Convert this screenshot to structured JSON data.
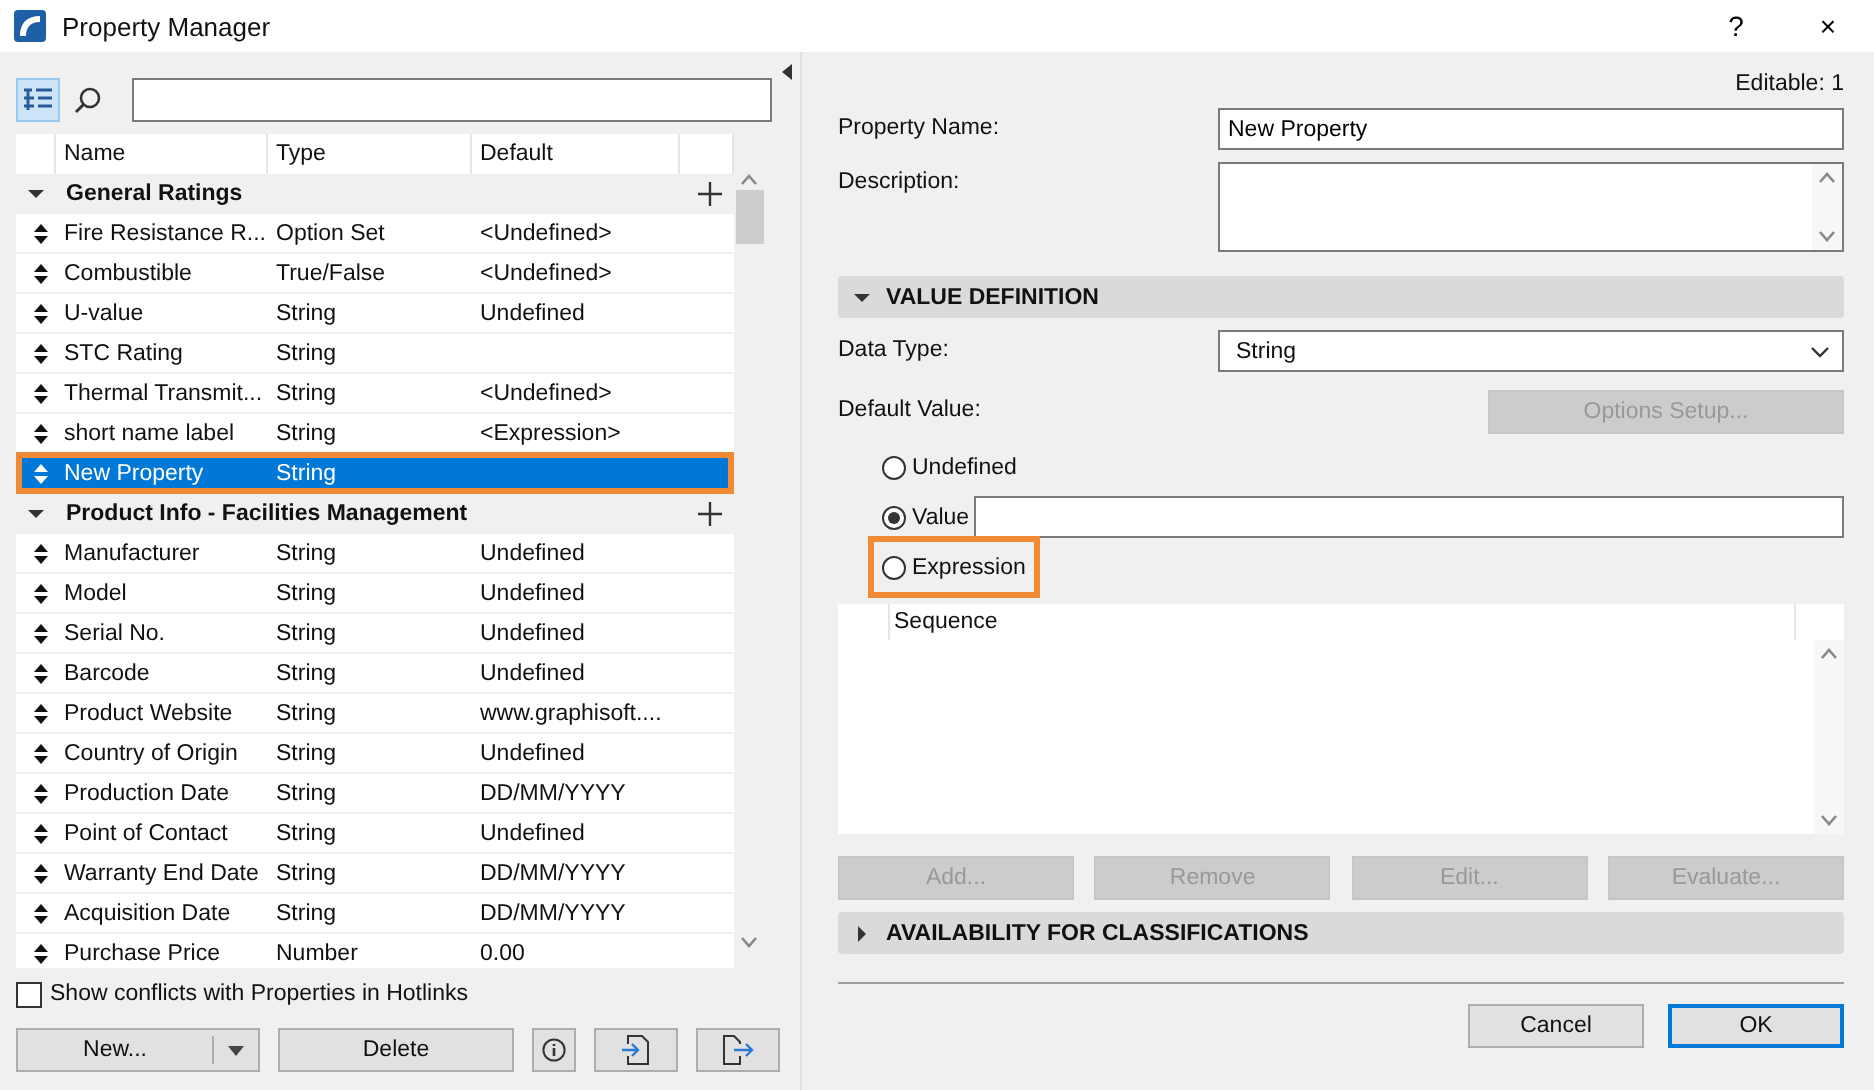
{
  "window": {
    "title": "Property Manager",
    "help": "?",
    "close": "×"
  },
  "table": {
    "columns": [
      "Name",
      "Type",
      "Default"
    ],
    "groups": [
      {
        "name": "General Ratings",
        "expanded": true,
        "rows": [
          {
            "name": "Fire Resistance R...",
            "type": "Option Set",
            "default": "<Undefined>",
            "selected": false,
            "highlighted": false
          },
          {
            "name": "Combustible",
            "type": "True/False",
            "default": "<Undefined>",
            "selected": false,
            "highlighted": false
          },
          {
            "name": "U-value",
            "type": "String",
            "default": "Undefined",
            "selected": false,
            "highlighted": false
          },
          {
            "name": "STC Rating",
            "type": "String",
            "default": "",
            "selected": false,
            "highlighted": false
          },
          {
            "name": "Thermal Transmit...",
            "type": "String",
            "default": "<Undefined>",
            "selected": false,
            "highlighted": false
          },
          {
            "name": "short name label",
            "type": "String",
            "default": "<Expression>",
            "selected": false,
            "highlighted": false
          },
          {
            "name": "New Property",
            "type": "String",
            "default": "",
            "selected": true,
            "highlighted": true
          }
        ]
      },
      {
        "name": "Product Info - Facilities Management",
        "expanded": true,
        "rows": [
          {
            "name": "Manufacturer",
            "type": "String",
            "default": "Undefined",
            "selected": false,
            "highlighted": false
          },
          {
            "name": "Model",
            "type": "String",
            "default": "Undefined",
            "selected": false,
            "highlighted": false
          },
          {
            "name": "Serial No.",
            "type": "String",
            "default": "Undefined",
            "selected": false,
            "highlighted": false
          },
          {
            "name": "Barcode",
            "type": "String",
            "default": "Undefined",
            "selected": false,
            "highlighted": false
          },
          {
            "name": "Product Website",
            "type": "String",
            "default": "www.graphisoft....",
            "selected": false,
            "highlighted": false
          },
          {
            "name": "Country of Origin",
            "type": "String",
            "default": "Undefined",
            "selected": false,
            "highlighted": false
          },
          {
            "name": "Production Date",
            "type": "String",
            "default": "DD/MM/YYYY",
            "selected": false,
            "highlighted": false
          },
          {
            "name": "Point of Contact",
            "type": "String",
            "default": "Undefined",
            "selected": false,
            "highlighted": false
          },
          {
            "name": "Warranty End Date",
            "type": "String",
            "default": "DD/MM/YYYY",
            "selected": false,
            "highlighted": false
          },
          {
            "name": "Acquisition Date",
            "type": "String",
            "default": "DD/MM/YYYY",
            "selected": false,
            "highlighted": false
          },
          {
            "name": "Purchase Price",
            "type": "Number",
            "default": "0.00",
            "selected": false,
            "highlighted": false
          }
        ]
      }
    ]
  },
  "show_conflicts": {
    "label": "Show conflicts with Properties in Hotlinks",
    "checked": false
  },
  "left_buttons": {
    "new": "New...",
    "delete": "Delete"
  },
  "editable": "Editable: 1",
  "property_name": {
    "label": "Property Name:",
    "value": "New Property"
  },
  "description": {
    "label": "Description:"
  },
  "value_definition": {
    "title": "VALUE DEFINITION",
    "expanded": true
  },
  "data_type": {
    "label": "Data Type:",
    "value": "String"
  },
  "default_value": {
    "label": "Default Value:",
    "options_button": "Options Setup...",
    "options_disabled": true,
    "options": [
      {
        "label": "Undefined",
        "selected": false,
        "highlighted": false
      },
      {
        "label": "Value",
        "selected": true,
        "highlighted": false
      },
      {
        "label": "Expression",
        "selected": false,
        "highlighted": true
      }
    ]
  },
  "expression_table": {
    "column": "Sequence"
  },
  "expression_buttons": [
    {
      "label": "Add...",
      "disabled": true
    },
    {
      "label": "Remove",
      "disabled": true
    },
    {
      "label": "Edit...",
      "disabled": true
    },
    {
      "label": "Evaluate...",
      "disabled": true
    }
  ],
  "availability": {
    "title": "AVAILABILITY FOR CLASSIFICATIONS",
    "expanded": false
  },
  "dialog_buttons": [
    {
      "label": "Cancel",
      "default": false
    },
    {
      "label": "OK",
      "default": true
    }
  ]
}
